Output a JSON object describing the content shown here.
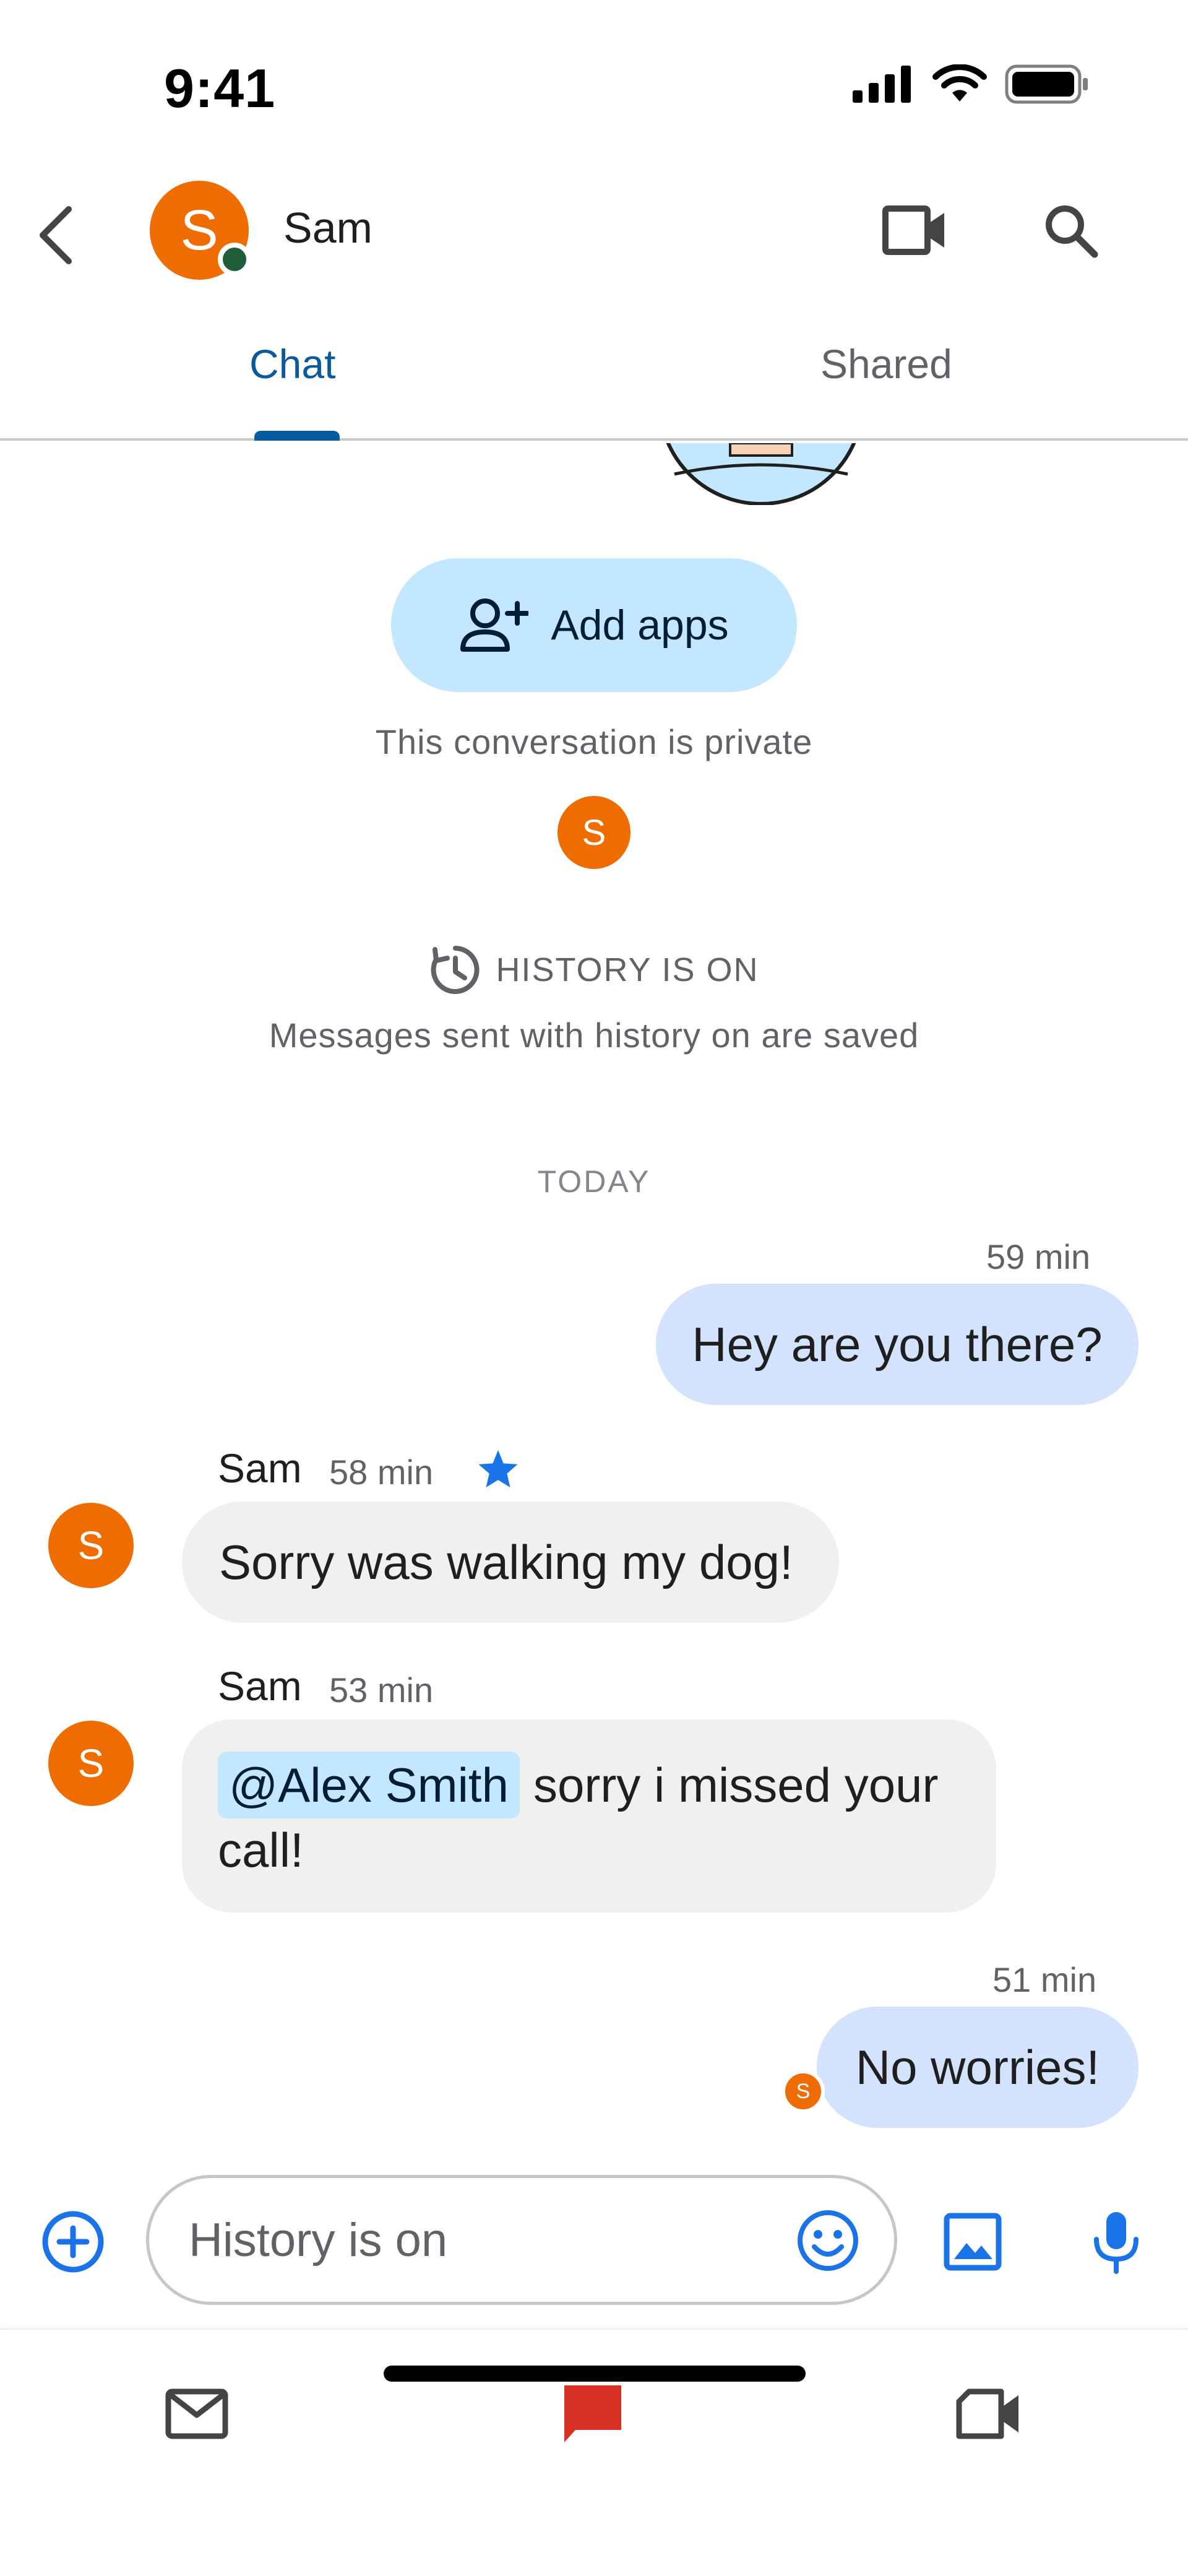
{
  "status_bar": {
    "time": "9:41"
  },
  "header": {
    "contact_name": "Sam",
    "avatar_initial": "S"
  },
  "tabs": [
    {
      "label": "Chat",
      "active": true
    },
    {
      "label": "Shared",
      "active": false
    }
  ],
  "intro": {
    "add_apps_label": "Add apps",
    "private_text": "This conversation is private",
    "member_initial": "S",
    "history_title": "HISTORY IS ON",
    "history_desc": "Messages sent with history on are saved"
  },
  "date_divider": "TODAY",
  "messages": [
    {
      "direction": "out",
      "time": "59 min",
      "text": "Hey are you there?"
    },
    {
      "direction": "in",
      "sender": "Sam",
      "initial": "S",
      "time": "58 min",
      "starred": true,
      "text": "Sorry was walking my dog!"
    },
    {
      "direction": "in",
      "sender": "Sam",
      "initial": "S",
      "time": "53 min",
      "mention": "@Alex Smith",
      "text_line1": "sorry i missed your",
      "text_line2": "call!"
    },
    {
      "direction": "out",
      "time": "51 min",
      "text": "No worries!",
      "read_initial": "S"
    }
  ],
  "compose": {
    "placeholder": "History is on"
  },
  "colors": {
    "accent": "#0a5aa0",
    "avatar": "#ef6c00",
    "outgoing_bubble": "#d3e3fd",
    "incoming_bubble": "#f0f0f0",
    "chip": "#c2e7ff",
    "chat_nav_active": "#d93025"
  },
  "icons": [
    "back-icon",
    "video-call-icon",
    "search-icon",
    "add-person-icon",
    "history-icon",
    "star-icon",
    "add-circle-icon",
    "emoji-icon",
    "image-icon",
    "mic-icon",
    "mail-icon",
    "chat-icon",
    "meet-icon"
  ]
}
